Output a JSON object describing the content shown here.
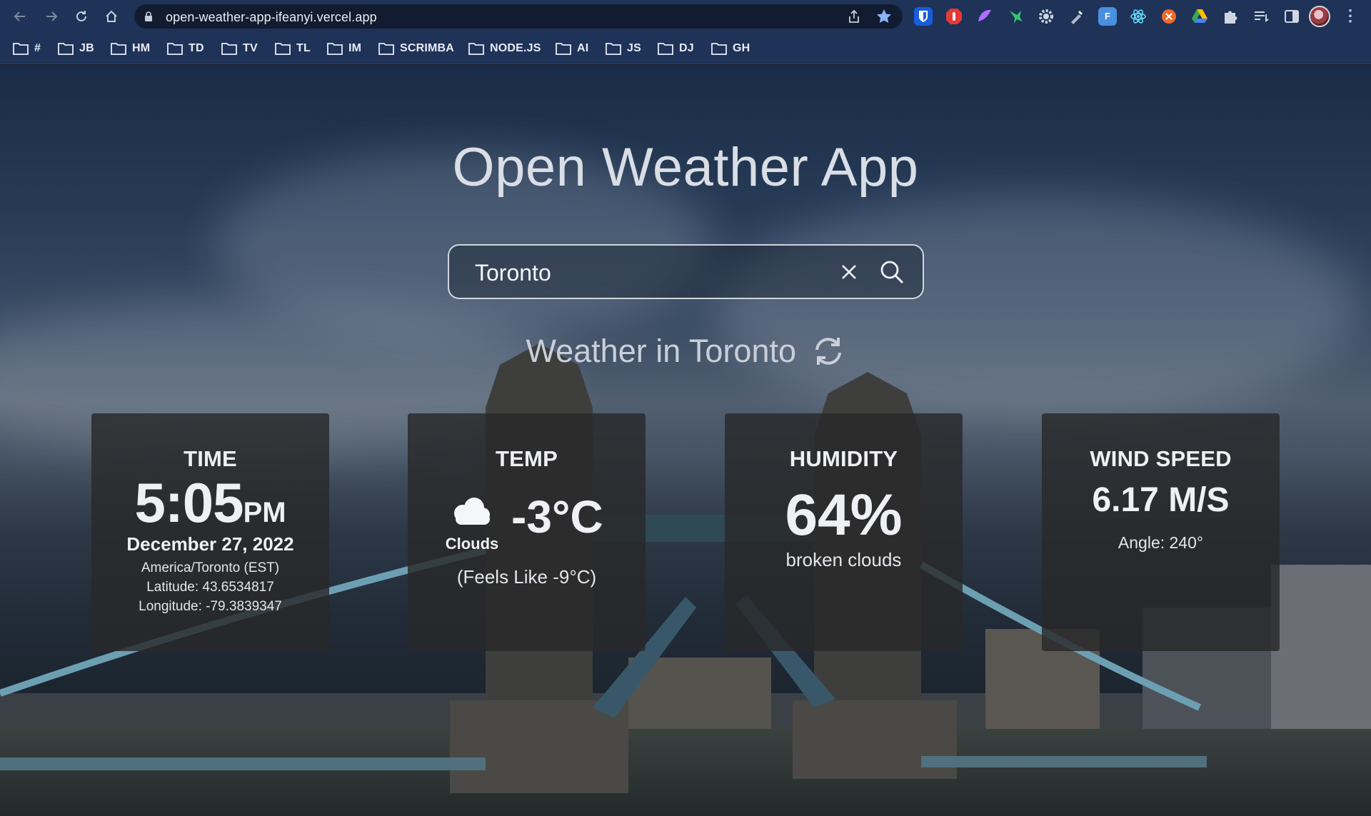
{
  "browser": {
    "url": "open-weather-app-ifeanyi.vercel.app",
    "bookmarks": [
      "#",
      "JB",
      "HM",
      "TD",
      "TV",
      "TL",
      "IM",
      "SCRIMBA",
      "NODE.JS",
      "AI",
      "JS",
      "DJ",
      "GH"
    ],
    "extensions": [
      "bitwarden-icon",
      "adblock-icon",
      "wave-icon",
      "hummingbird-icon",
      "gear-icon",
      "eyedropper-icon",
      "font-icon",
      "react-devtools-icon",
      "pomodoro-icon",
      "google-drive-icon",
      "puzzle-icon",
      "reading-list-icon",
      "side-panel-icon"
    ],
    "extension_labels": {
      "font": "F"
    }
  },
  "app": {
    "title": "Open Weather App",
    "search": {
      "value": "Toronto"
    },
    "heading": "Weather in Toronto"
  },
  "cards": {
    "time": {
      "label": "TIME",
      "time": "5:05",
      "ampm": "PM",
      "date": "December 27, 2022",
      "timezone": "America/Toronto (EST)",
      "latitude": "Latitude: 43.6534817",
      "longitude": "Longitude: -79.3839347"
    },
    "temp": {
      "label": "TEMP",
      "condition": "Clouds",
      "value": "-3°C",
      "feels_like": "(Feels Like -9°C)"
    },
    "humidity": {
      "label": "HUMIDITY",
      "value": "64%",
      "description": "broken clouds"
    },
    "wind": {
      "label": "WIND SPEED",
      "value": "6.17 M/S",
      "angle": "Angle: 240°"
    }
  }
}
